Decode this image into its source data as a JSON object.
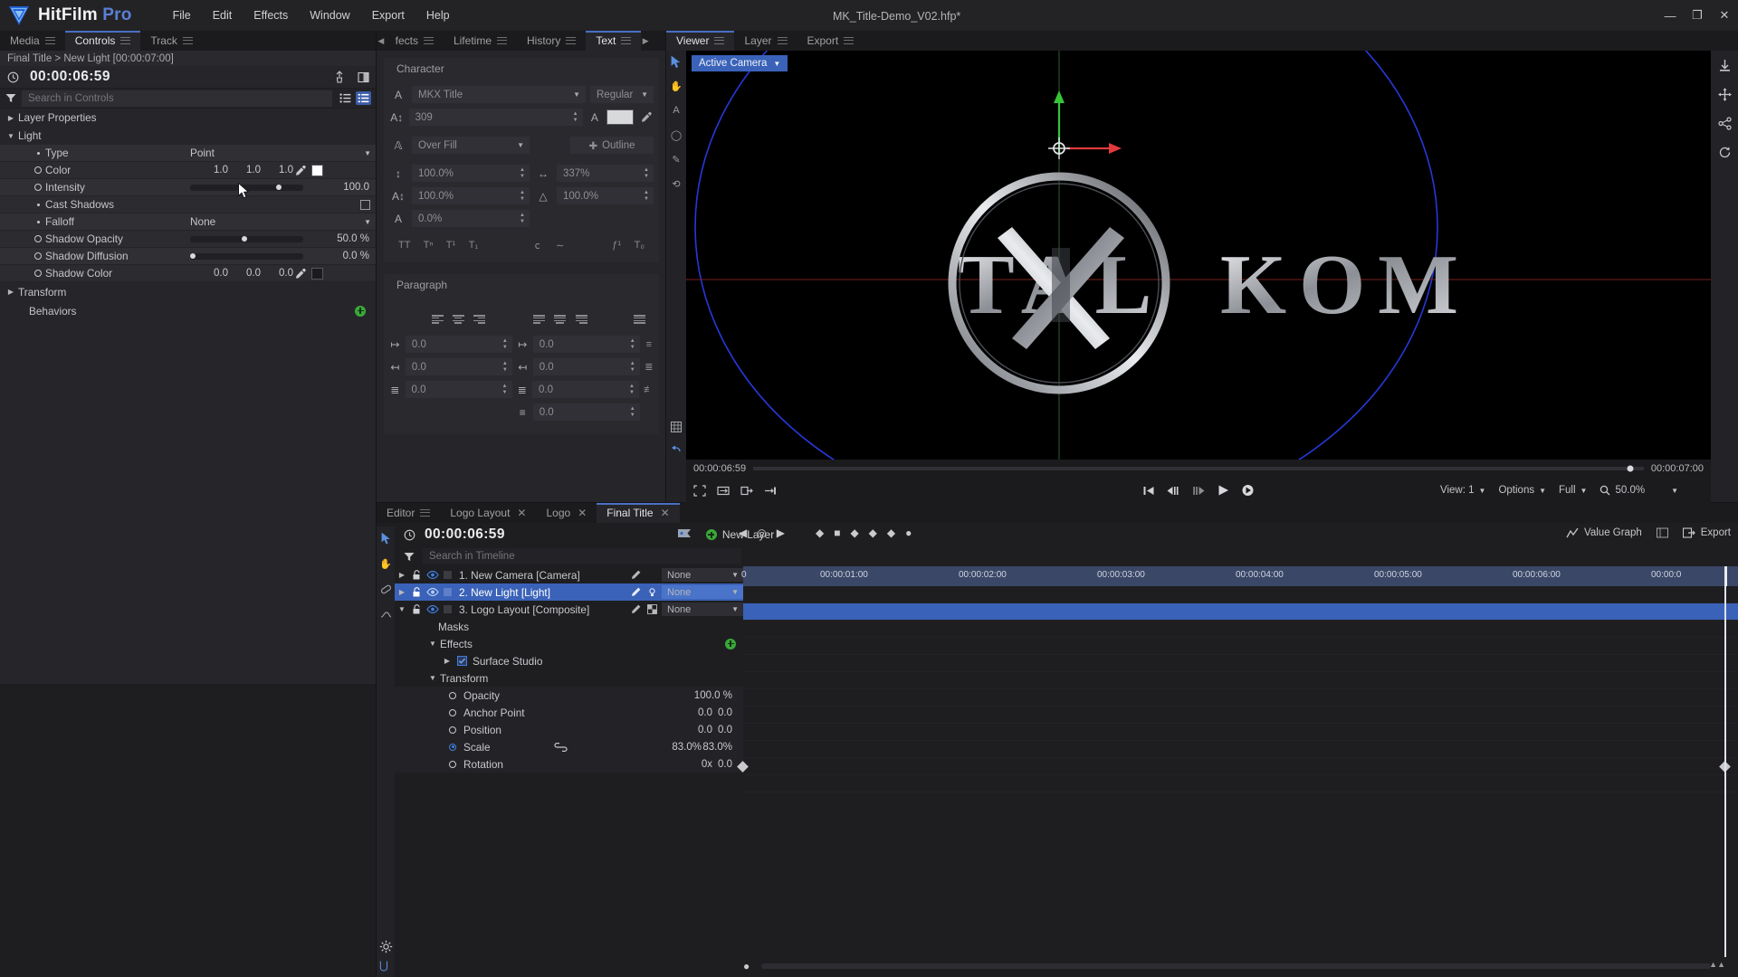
{
  "app": {
    "brand_main": "HitFilm",
    "brand_sub": "Pro",
    "document_title": "MK_Title-Demo_V02.hfp*",
    "menu": [
      "File",
      "Edit",
      "Effects",
      "Window",
      "Export",
      "Help"
    ],
    "window_buttons": {
      "minimize": "—",
      "maximize": "❐",
      "close": "✕"
    }
  },
  "controls_panel": {
    "tabs": [
      {
        "label": "Media",
        "active": false
      },
      {
        "label": "Controls",
        "active": true
      },
      {
        "label": "Track",
        "active": false
      }
    ],
    "breadcrumb": "Final Title > New Light [00:00:07:00]",
    "timecode": "00:00:06:59",
    "search_placeholder": "Search in Controls",
    "groups": [
      {
        "label": "Layer Properties",
        "expanded": false
      },
      {
        "label": "Light",
        "expanded": true
      },
      {
        "label": "Transform",
        "expanded": false
      },
      {
        "label": "Behaviors",
        "expanded": false
      }
    ],
    "light_properties": [
      {
        "name": "Type",
        "kind": "dropdown",
        "value": "Point",
        "keyframable": false
      },
      {
        "name": "Color",
        "kind": "color",
        "values": [
          "1.0",
          "1.0",
          "1.0"
        ],
        "swatch": "#ffffff",
        "keyframable": true
      },
      {
        "name": "Intensity",
        "kind": "slider",
        "value": "100.0",
        "fill": 0.78,
        "keyframable": true
      },
      {
        "name": "Cast Shadows",
        "kind": "checkbox",
        "checked": false,
        "keyframable": false
      },
      {
        "name": "Falloff",
        "kind": "dropdown",
        "value": "None",
        "keyframable": false
      },
      {
        "name": "Shadow Opacity",
        "kind": "slider",
        "value": "50.0 %",
        "fill": 0.48,
        "keyframable": true
      },
      {
        "name": "Shadow Diffusion",
        "kind": "slider",
        "value": "0.0 %",
        "fill": 0.02,
        "keyframable": true
      },
      {
        "name": "Shadow Color",
        "kind": "color",
        "values": [
          "0.0",
          "0.0",
          "0.0"
        ],
        "swatch": "#1b1b1d",
        "keyframable": true
      }
    ]
  },
  "text_panel": {
    "tabs": [
      {
        "label": "fects",
        "active": false
      },
      {
        "label": "Lifetime",
        "active": false
      },
      {
        "label": "History",
        "active": false
      },
      {
        "label": "Text",
        "active": true
      }
    ],
    "character": {
      "section_title": "Character",
      "font_family": "MKX Title",
      "font_style": "Regular",
      "font_size": "309",
      "fill_color": "#d8d9db",
      "stroke_mode": "Over Fill",
      "outline_button": "Outline",
      "vertical_scale": "100.0%",
      "tracking": "337%",
      "horizontal_scale": "100.0%",
      "baseline_shift": "100.0%",
      "skew": "0.0%"
    },
    "paragraph": {
      "section_title": "Paragraph",
      "indent_left": "0.0",
      "indent_right": "0.0",
      "indent_first": "0.0",
      "space_before": "0.0",
      "space_after": "0.0",
      "line_leading": "0.0",
      "para_leading": "0.0"
    }
  },
  "viewer_panel": {
    "tabs": [
      {
        "label": "Viewer",
        "active": true
      },
      {
        "label": "Layer",
        "active": false
      },
      {
        "label": "Export",
        "active": false
      }
    ],
    "camera_selector": "Active Camera",
    "current_time": "00:00:06:59",
    "duration": "00:00:07:00",
    "playhead_fraction": 0.985,
    "view_label": "View: 1",
    "options_label": "Options",
    "quality_label": "Full",
    "zoom_label": "50.0%",
    "artwork_text_left": "TAL",
    "artwork_text_right": "KOM"
  },
  "timeline_panel": {
    "tabs": [
      {
        "label": "Editor",
        "active": false,
        "closable": false
      },
      {
        "label": "Logo Layout",
        "active": false,
        "closable": true
      },
      {
        "label": "Logo",
        "active": false,
        "closable": true
      },
      {
        "label": "Final Title",
        "active": true,
        "closable": true
      }
    ],
    "timecode": "00:00:06:59",
    "new_layer_label": "New Layer",
    "search_placeholder": "Search in Timeline",
    "value_graph_label": "Value Graph",
    "export_label": "Export",
    "ruler_labels": [
      "00:00:01:00",
      "00:00:02:00",
      "00:00:03:00",
      "00:00:04:00",
      "00:00:05:00",
      "00:00:06:00",
      "00:00:0"
    ],
    "layers": [
      {
        "label": "1. New Camera [Camera]",
        "parent": "None",
        "selected": false,
        "expanded": false
      },
      {
        "label": "2. New Light [Light]",
        "parent": "None",
        "selected": true,
        "expanded": false
      },
      {
        "label": "3. Logo Layout [Composite]",
        "parent": "None",
        "selected": false,
        "expanded": true
      }
    ],
    "sub_items": [
      {
        "label": "Masks",
        "indent": 2,
        "kind": "group"
      },
      {
        "label": "Effects",
        "indent": 2,
        "kind": "group",
        "has_add": true
      },
      {
        "label": "Surface Studio",
        "indent": 3,
        "kind": "effect",
        "checked": true
      },
      {
        "label": "Transform",
        "indent": 2,
        "kind": "group"
      }
    ],
    "transform_properties": [
      {
        "name": "Opacity",
        "values": [
          "100.0 %"
        ],
        "keyed": false
      },
      {
        "name": "Anchor Point",
        "values": [
          "0.0",
          "0.0"
        ],
        "keyed": false
      },
      {
        "name": "Position",
        "values": [
          "0.0",
          "0.0"
        ],
        "keyed": false
      },
      {
        "name": "Scale",
        "values": [
          "83.0%",
          "83.0%"
        ],
        "keyed": true,
        "linked": true
      },
      {
        "name": "Rotation",
        "values": [
          "0x",
          "0.0"
        ],
        "keyed": false
      }
    ]
  },
  "colors": {
    "accent_blue": "#3a62b8",
    "panel_bg": "#26262a",
    "tab_bg": "#1b1b1e",
    "ruler_blue": "#3b4766",
    "green_add": "#3aa93a"
  }
}
